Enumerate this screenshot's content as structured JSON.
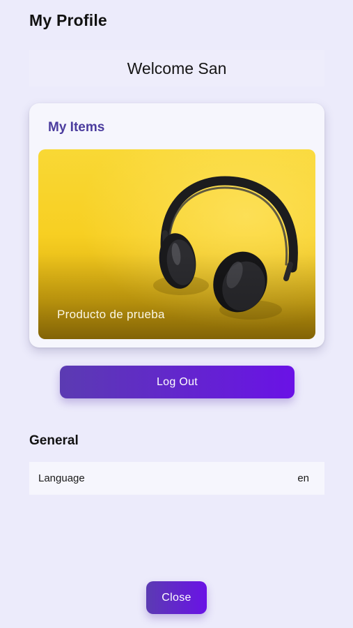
{
  "header": {
    "title": "My Profile"
  },
  "welcome": {
    "text": "Welcome San"
  },
  "items_card": {
    "title": "My Items",
    "items": [
      {
        "label": "Producto de prueba",
        "image": "headphones-on-yellow"
      }
    ]
  },
  "actions": {
    "logout_label": "Log Out",
    "close_label": "Close"
  },
  "general": {
    "title": "General",
    "settings": [
      {
        "label": "Language",
        "value": "en"
      }
    ]
  },
  "colors": {
    "background": "#ecebfb",
    "accent_title": "#4b3c9e",
    "button_gradient_start": "#5b3bb2",
    "button_gradient_end": "#6a12e6",
    "product_background": "#f7cf22"
  }
}
